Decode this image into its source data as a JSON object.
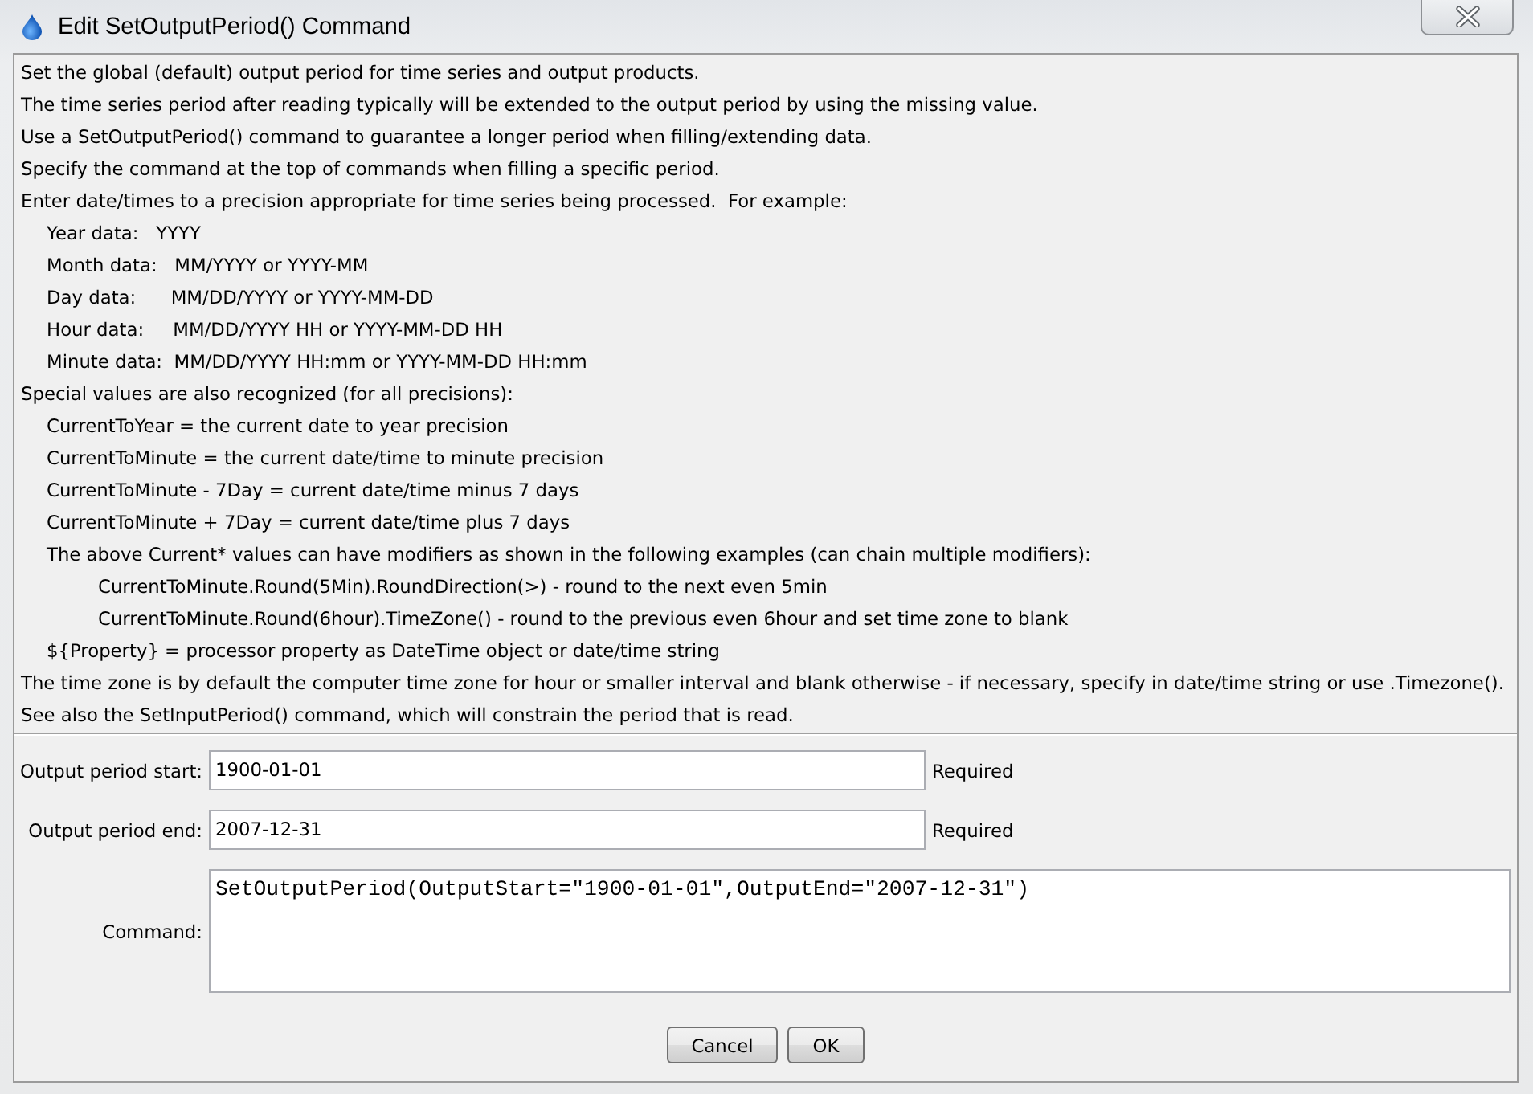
{
  "window": {
    "title": "Edit SetOutputPeriod() Command"
  },
  "description": [
    {
      "text": "Set the global (default) output period for time series and output products."
    },
    {
      "text": "The time series period after reading typically will be extended to the output period by using the missing value."
    },
    {
      "text": "Use a SetOutputPeriod() command to guarantee a longer period when filling/extending data."
    },
    {
      "text": "Specify the command at the top of commands when filling a specific period."
    },
    {
      "text": "Enter date/times to a precision appropriate for time series being processed.  For example:",
      "children": [
        {
          "text": "Year data:   YYYY"
        },
        {
          "text": "Month data:   MM/YYYY or YYYY-MM"
        },
        {
          "text": "Day data:      MM/DD/YYYY or YYYY-MM-DD"
        },
        {
          "text": "Hour data:     MM/DD/YYYY HH or YYYY-MM-DD HH"
        },
        {
          "text": "Minute data:  MM/DD/YYYY HH:mm or YYYY-MM-DD HH:mm"
        }
      ]
    },
    {
      "text": "Special values are also recognized (for all precisions):",
      "children": [
        {
          "text": "CurrentToYear = the current date to year precision"
        },
        {
          "text": "CurrentToMinute = the current date/time to minute precision"
        },
        {
          "text": "CurrentToMinute - 7Day = current date/time minus 7 days"
        },
        {
          "text": "CurrentToMinute + 7Day = current date/time plus 7 days"
        },
        {
          "text": "The above Current* values can have modifiers as shown in the following examples (can chain multiple modifiers):",
          "children": [
            {
              "text": "CurrentToMinute.Round(5Min).RoundDirection(>) - round to the next even 5min"
            },
            {
              "text": "CurrentToMinute.Round(6hour).TimeZone() - round to the previous even 6hour and set time zone to blank"
            }
          ]
        },
        {
          "text": "${Property} = processor property as DateTime object or date/time string"
        }
      ]
    },
    {
      "text": "The time zone is by default the computer time zone for hour or smaller interval and blank otherwise - if necessary, specify in date/time string or use .Timezone()."
    },
    {
      "text": "See also the SetInputPeriod() command, which will constrain the period that is read."
    }
  ],
  "form": {
    "fields": [
      {
        "kind": "text",
        "label": "Output period start:",
        "value": "1900-01-01",
        "note": "Required"
      },
      {
        "kind": "text",
        "label": "Output period end:",
        "value": "2007-12-31",
        "note": "Required"
      },
      {
        "kind": "textarea",
        "label": "Command:",
        "value": "SetOutputPeriod(OutputStart=\"1900-01-01\",OutputEnd=\"2007-12-31\")"
      }
    ]
  },
  "buttons": [
    {
      "label": "Cancel"
    },
    {
      "label": "OK"
    }
  ]
}
